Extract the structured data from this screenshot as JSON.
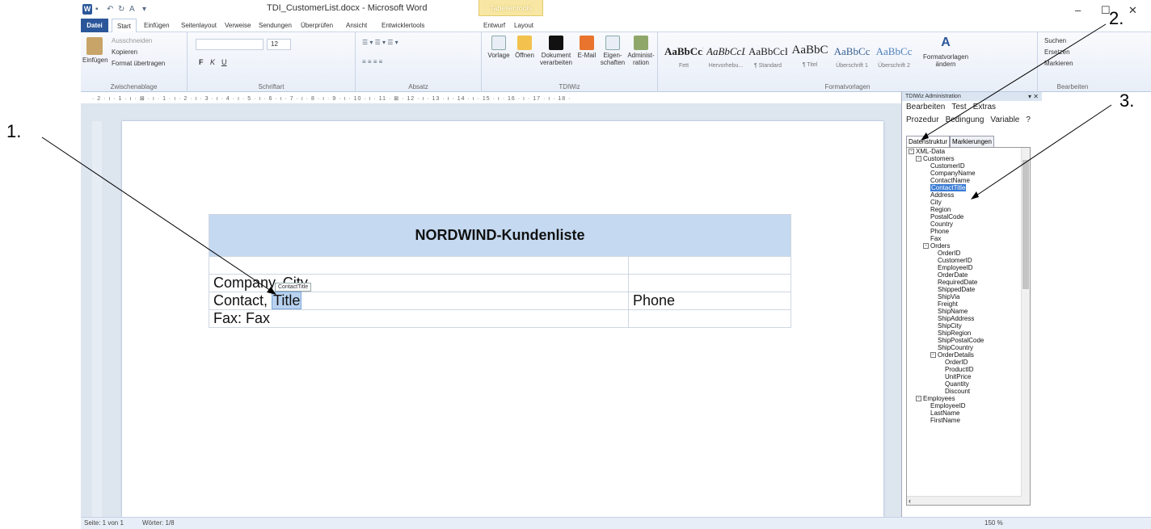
{
  "window": {
    "title": "TDI_CustomerList.docx - Microsoft Word",
    "context_group": "Tabellentools",
    "controls": {
      "minimize": "–",
      "maximize": "☐",
      "close": "✕"
    }
  },
  "tabs": [
    "Datei",
    "Start",
    "Einfügen",
    "Seitenlayout",
    "Verweise",
    "Sendungen",
    "Überprüfen",
    "Ansicht",
    "Entwicklertools",
    "Entwurf",
    "Layout"
  ],
  "ribbon": {
    "clipboard": {
      "paste": "Einfügen",
      "cut": "Ausschneiden",
      "copy": "Kopieren",
      "format_painter": "Format übertragen",
      "label": "Zwischenablage"
    },
    "font": {
      "size": "12",
      "label": "Schriftart"
    },
    "paragraph": {
      "label": "Absatz"
    },
    "tdiwiz": {
      "buttons": [
        "Vorlage",
        "Öffnen",
        "Dokument verarbeiten",
        "E-Mail",
        "Eigen-schaften",
        "Administ-ration"
      ],
      "label": "TDIWiz"
    },
    "styles": {
      "items": [
        {
          "preview": "AaBbCcI",
          "label": "Fett"
        },
        {
          "preview": "AaBbCcL",
          "label": "Hervorhebu..."
        },
        {
          "preview": "AaBbCcI",
          "label": "¶ Standard"
        },
        {
          "preview": "AaBbC",
          "label": "¶ Titel"
        },
        {
          "preview": "AaBbCc",
          "label": "Überschrift 1"
        },
        {
          "preview": "AaBbCc",
          "label": "Überschrift 2"
        }
      ],
      "change": "Formatvorlagen ändern",
      "label": "Formatvorlagen"
    },
    "editing": {
      "find": "Suchen",
      "replace": "Ersetzen",
      "select": "Markieren",
      "label": "Bearbeiten"
    }
  },
  "ruler": "· 2 · ı · 1 · ı · ⊠ · ı · 1 · ı · 2 · ı · 3 · ı · 4 · ı · 5 · ı · 6 · ı · 7 · ı · 8 · ı · 9 · ı · 10 · ı · 11 · ⊠ · 12 · ı · 13 · ı · 14 · ı · 15 · ı · 16 · ı · 17 · ı · 18 ·",
  "document": {
    "heading": "NORDWIND-Kundenliste",
    "row_company": "Company, City",
    "row_contact_prefix": "Contact, ",
    "row_contact_field": "Title",
    "row_phone": "Phone",
    "row_fax": "Fax: Fax",
    "tooltip": "ContactTitle"
  },
  "pane": {
    "title": "TDIWiz Administration",
    "menu1": [
      "Bearbeiten",
      "Test",
      "Extras"
    ],
    "menu2": [
      "Prozedur",
      "Bedingung",
      "Variable",
      "?"
    ],
    "tabs": [
      "Datenstruktur",
      "Markierungen"
    ],
    "tree": [
      {
        "label": "XML-Data",
        "level": 0,
        "exp": "⊟"
      },
      {
        "label": "Customers",
        "level": 1,
        "exp": "⊟"
      },
      {
        "label": "CustomerID",
        "level": 2
      },
      {
        "label": "CompanyName",
        "level": 2
      },
      {
        "label": "ContactName",
        "level": 2
      },
      {
        "label": "ContactTitle",
        "level": 2,
        "selected": true
      },
      {
        "label": "Address",
        "level": 2
      },
      {
        "label": "City",
        "level": 2
      },
      {
        "label": "Region",
        "level": 2
      },
      {
        "label": "PostalCode",
        "level": 2
      },
      {
        "label": "Country",
        "level": 2
      },
      {
        "label": "Phone",
        "level": 2
      },
      {
        "label": "Fax",
        "level": 2
      },
      {
        "label": "Orders",
        "level": 2,
        "exp": "⊟"
      },
      {
        "label": "OrderID",
        "level": 3
      },
      {
        "label": "CustomerID",
        "level": 3
      },
      {
        "label": "EmployeeID",
        "level": 3
      },
      {
        "label": "OrderDate",
        "level": 3
      },
      {
        "label": "RequiredDate",
        "level": 3
      },
      {
        "label": "ShippedDate",
        "level": 3
      },
      {
        "label": "ShipVia",
        "level": 3
      },
      {
        "label": "Freight",
        "level": 3
      },
      {
        "label": "ShipName",
        "level": 3
      },
      {
        "label": "ShipAddress",
        "level": 3
      },
      {
        "label": "ShipCity",
        "level": 3
      },
      {
        "label": "ShipRegion",
        "level": 3
      },
      {
        "label": "ShipPostalCode",
        "level": 3
      },
      {
        "label": "ShipCountry",
        "level": 3
      },
      {
        "label": "OrderDetails",
        "level": 3,
        "exp": "⊟"
      },
      {
        "label": "OrderID",
        "level": 4
      },
      {
        "label": "ProductID",
        "level": 4
      },
      {
        "label": "UnitPrice",
        "level": 4
      },
      {
        "label": "Quantity",
        "level": 4
      },
      {
        "label": "Discount",
        "level": 4
      },
      {
        "label": "Employees",
        "level": 1,
        "exp": "⊟"
      },
      {
        "label": "EmployeeID",
        "level": 2
      },
      {
        "label": "LastName",
        "level": 2
      },
      {
        "label": "FirstName",
        "level": 2
      }
    ]
  },
  "status": {
    "page": "Seite: 1 von 1",
    "words": "Wörter: 1/8",
    "zoom": "150 %"
  },
  "callouts": [
    "1.",
    "2.",
    "3."
  ],
  "colors": {
    "accent": "#2b579a",
    "table_header": "#c5d9f1",
    "selection": "#3a7bd5"
  }
}
